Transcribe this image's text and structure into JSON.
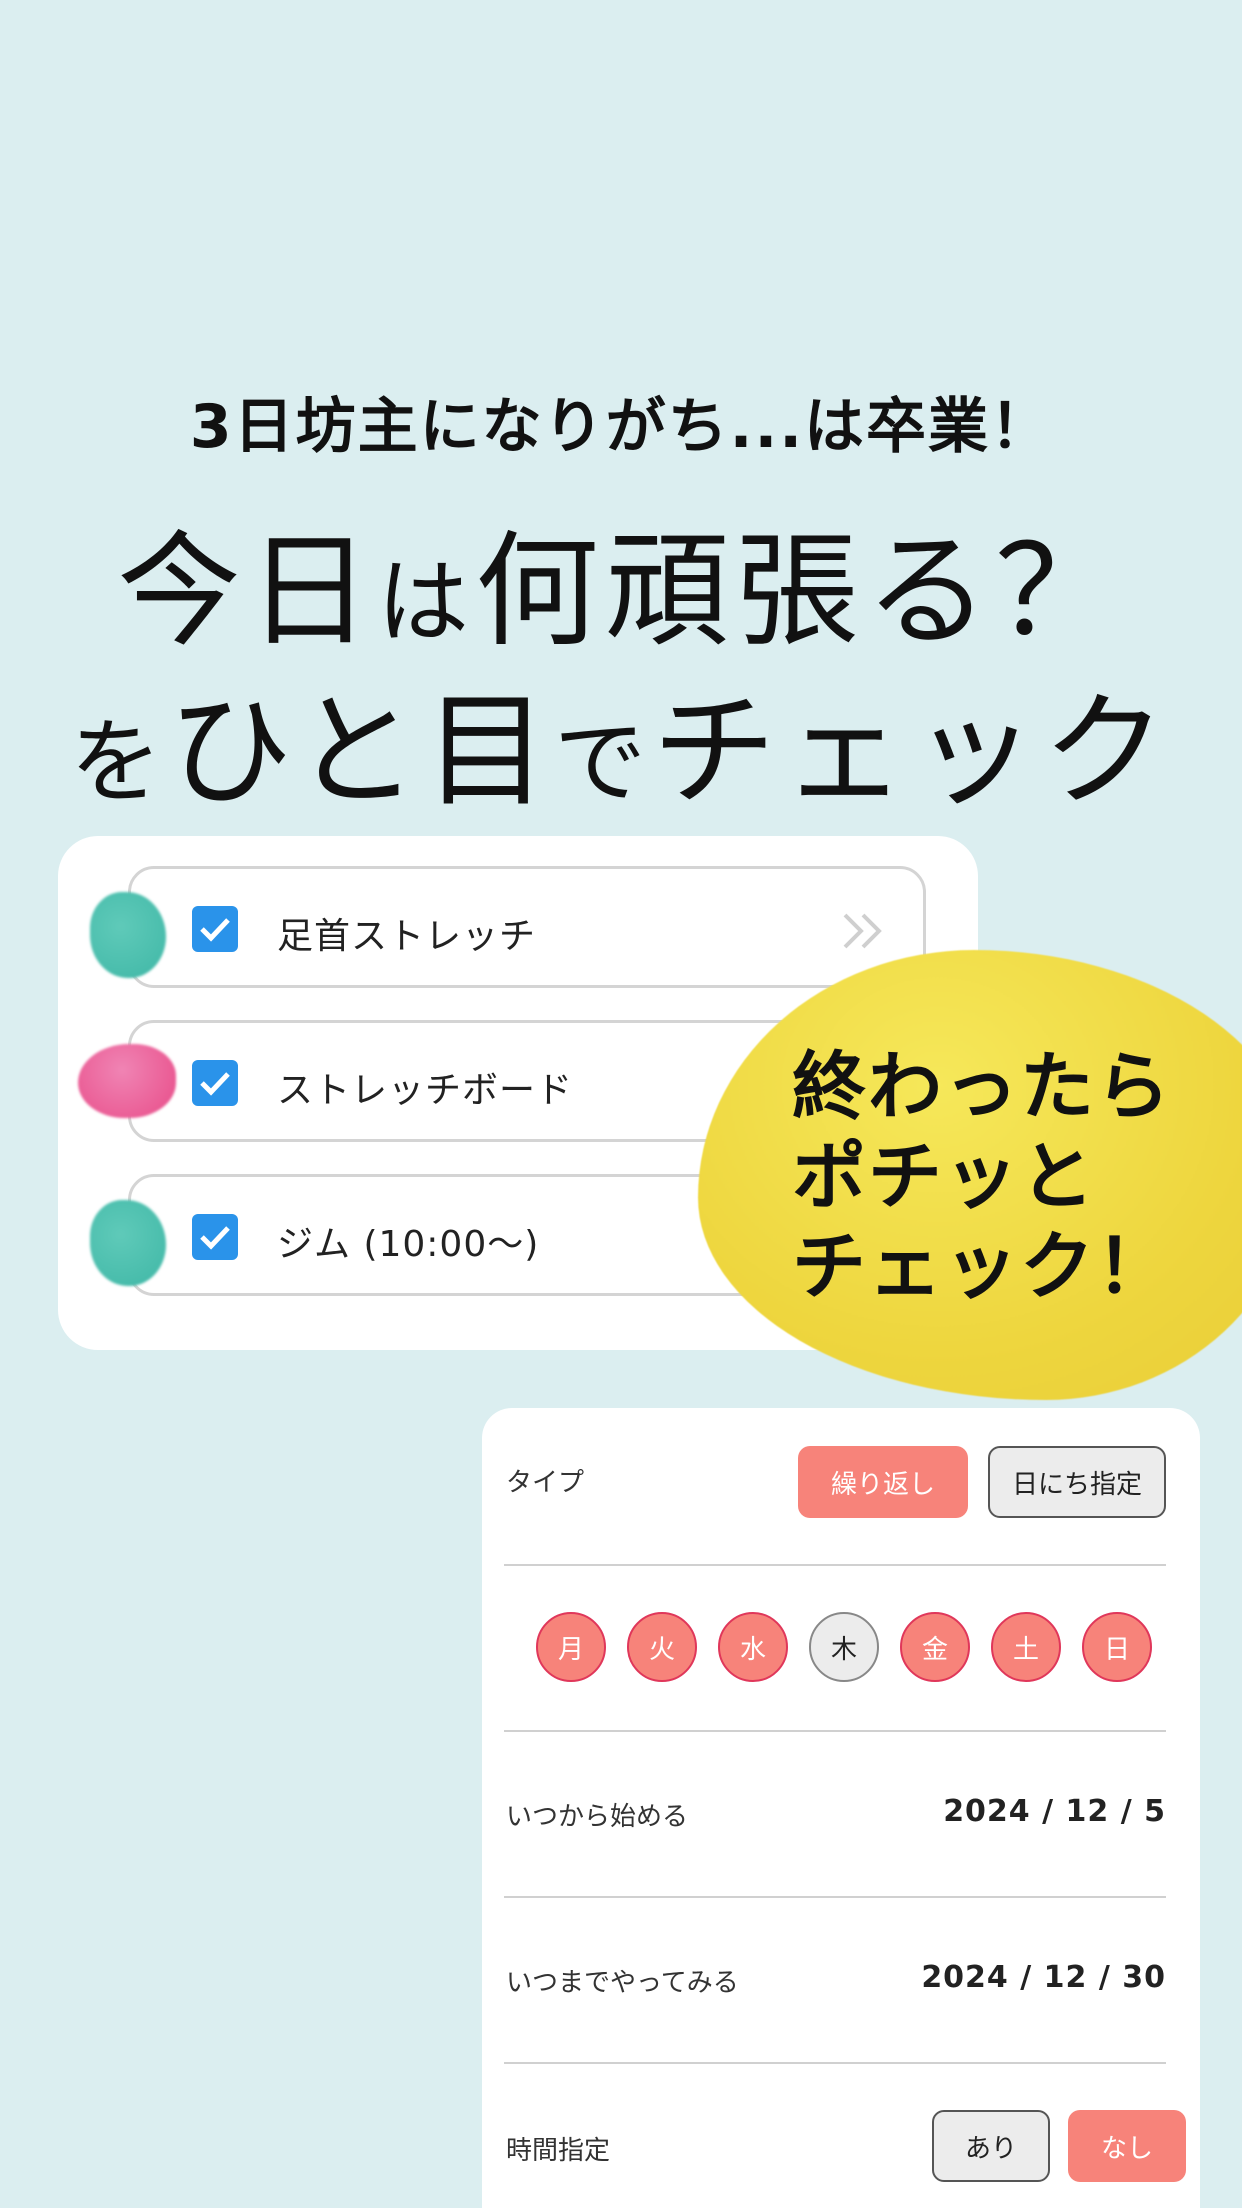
{
  "hero": {
    "subtitle": "3日坊主になりがち...は卒業！",
    "line1_a": "今日",
    "line1_b": "は",
    "line1_c": "何頑張る？",
    "line2_a": "を",
    "line2_b": "ひと",
    "line2_c": "目",
    "line2_d": "で",
    "line2_e": "チェック"
  },
  "tasks": [
    {
      "label": "足首ストレッチ",
      "checked": true,
      "color": "#45bba9"
    },
    {
      "label": "ストレッチボード",
      "checked": true,
      "color": "#e85a92"
    },
    {
      "label": "ジム (10:00〜)",
      "checked": true,
      "color": "#45bba9"
    }
  ],
  "bubble": {
    "line1": "終わったら",
    "line2": "ポチッと",
    "line3": "チェック！"
  },
  "settings": {
    "type_label": "タイプ",
    "type_repeat": "繰り返し",
    "type_date": "日にち指定",
    "days": [
      {
        "label": "月",
        "active": true
      },
      {
        "label": "火",
        "active": true
      },
      {
        "label": "水",
        "active": true
      },
      {
        "label": "木",
        "active": false
      },
      {
        "label": "金",
        "active": true
      },
      {
        "label": "土",
        "active": true
      },
      {
        "label": "日",
        "active": true
      }
    ],
    "start_label": "いつから始める",
    "start_value": "2024 / 12 / 5",
    "end_label": "いつまでやってみる",
    "end_value": "2024 / 12 / 30",
    "time_label": "時間指定",
    "time_yes": "あり",
    "time_no": "なし"
  },
  "colors": {
    "background": "#dbeef0",
    "accent": "#f7837a",
    "check": "#2a93ea",
    "bubble": "#f0d944"
  }
}
